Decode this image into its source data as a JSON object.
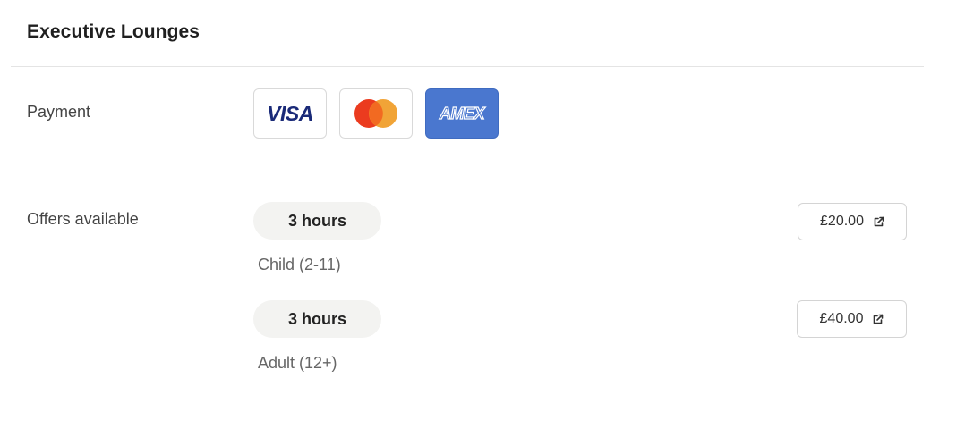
{
  "section": {
    "title": "Executive Lounges"
  },
  "payment": {
    "label": "Payment",
    "cards": [
      {
        "name": "VISA",
        "icon": "visa-logo",
        "text_color": "#1a2a78"
      },
      {
        "name": "Mastercard",
        "icon": "mastercard-logo",
        "colors": [
          "#eb3b1f",
          "#f09f2c"
        ]
      },
      {
        "name": "AMEX",
        "icon": "amex-logo",
        "background": "#4a77cf"
      }
    ]
  },
  "offers": {
    "label": "Offers available",
    "items": [
      {
        "duration": "3 hours",
        "audience": "Child (2-11)",
        "price": "£20.00",
        "icon": "external-link-icon"
      },
      {
        "duration": "3 hours",
        "audience": "Adult (12+)",
        "price": "£40.00",
        "icon": "external-link-icon"
      }
    ]
  }
}
